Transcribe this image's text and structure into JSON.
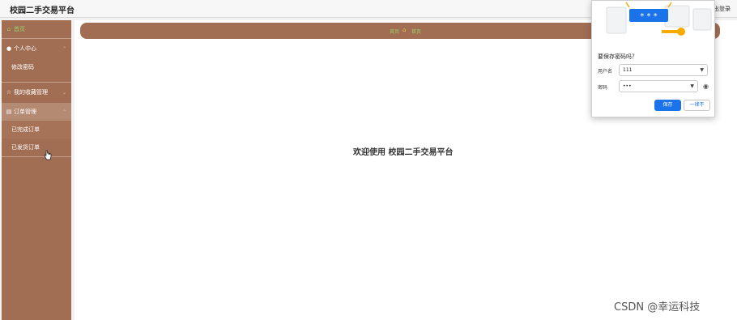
{
  "header": {
    "title": "校园二手交易平台",
    "logout_label": "退出登录"
  },
  "sidebar": {
    "items": [
      {
        "label": "首页",
        "icon": "home-icon"
      },
      {
        "label": "个人中心",
        "icon": "user-icon"
      },
      {
        "label": "修改密码"
      },
      {
        "label": "我的收藏管理",
        "icon": "star-icon"
      },
      {
        "label": "订单管理",
        "icon": "list-icon"
      },
      {
        "label": "已完成订单"
      },
      {
        "label": "已发货订单"
      }
    ]
  },
  "breadcrumb": {
    "item1": "首页",
    "item2": "首页"
  },
  "main": {
    "welcome": "欢迎使用 校园二手交易平台"
  },
  "password_dialog": {
    "question": "要保存密码吗？",
    "username_label": "用户名",
    "username_value": "111",
    "password_label": "密码",
    "password_value": "•••",
    "save_label": "保存",
    "never_label": "一律不"
  },
  "watermark": "CSDN @幸运科技",
  "colors": {
    "sidebar": "#a16e54",
    "accent_green": "#9ccf6a",
    "primary_button": "#1a73e8"
  }
}
